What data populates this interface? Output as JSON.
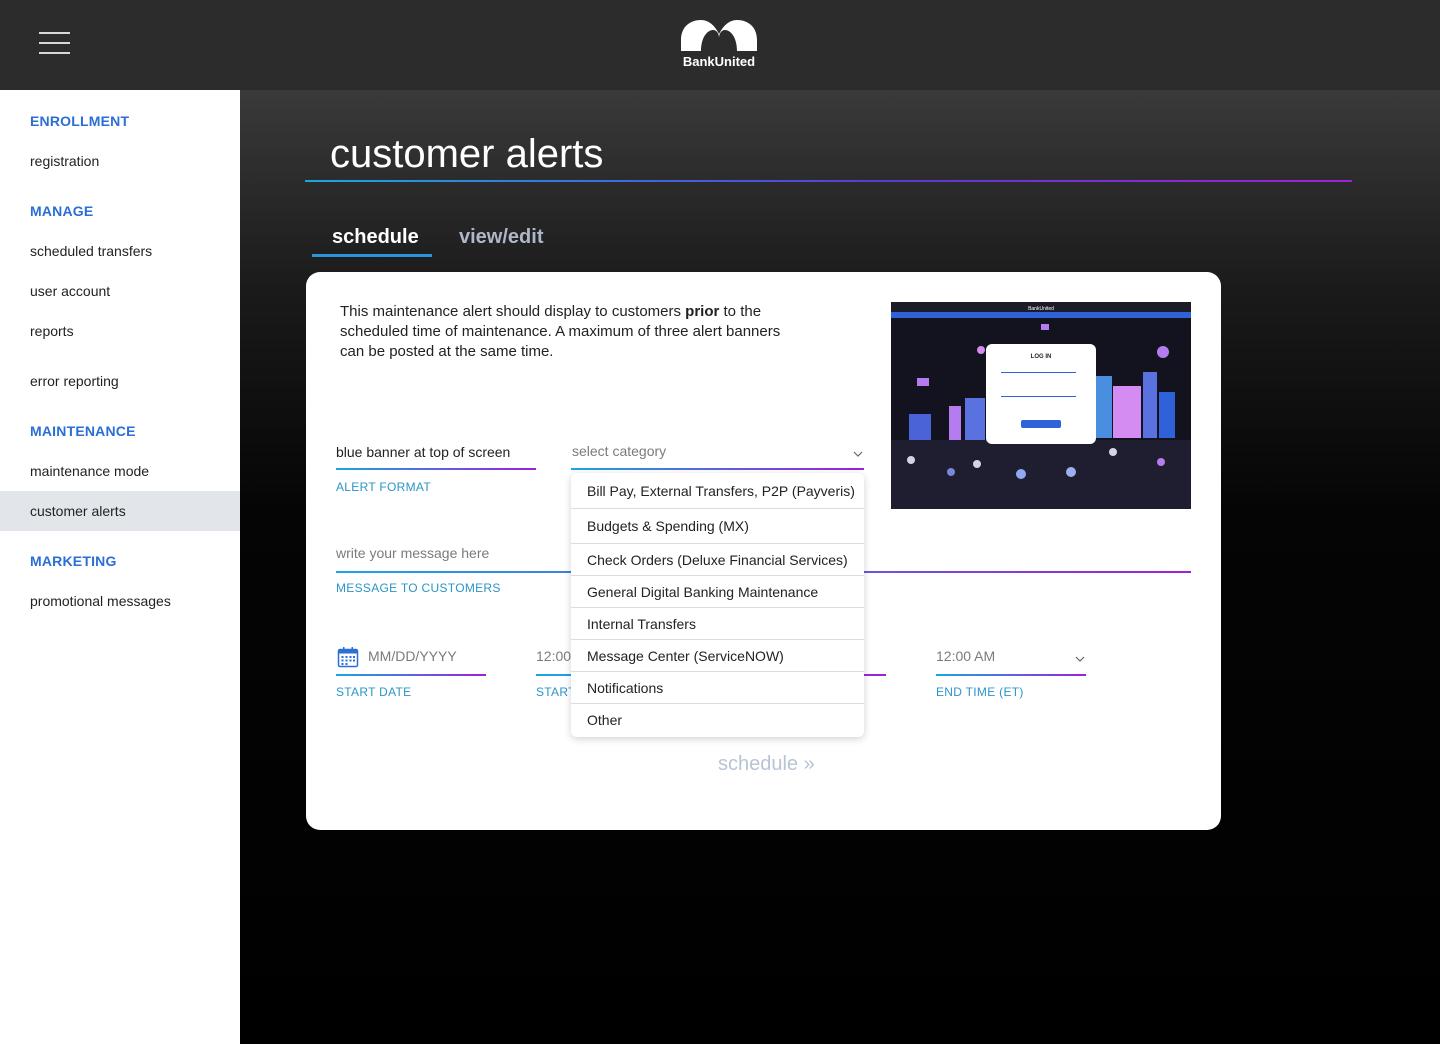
{
  "header": {
    "brand": "BankUnited",
    "menu_icon": "hamburger-menu-icon"
  },
  "sidebar": {
    "sections": [
      {
        "title": "ENROLLMENT",
        "items": [
          "registration"
        ]
      },
      {
        "title": "MANAGE",
        "items": [
          "scheduled transfers",
          "user account",
          "reports",
          "error reporting"
        ]
      },
      {
        "title": "MAINTENANCE",
        "items": [
          "maintenance mode",
          "customer alerts"
        ]
      },
      {
        "title": "MARKETING",
        "items": [
          "promotional messages"
        ]
      }
    ],
    "active_item": "customer alerts"
  },
  "page": {
    "title": "customer alerts",
    "tabs": [
      {
        "label": "schedule",
        "active": true
      },
      {
        "label": "view/edit",
        "active": false
      }
    ]
  },
  "form": {
    "intro_before": "This maintenance alert should display to customers ",
    "intro_bold": "prior",
    "intro_after": " to the scheduled time of maintenance. A maximum of three alert banners can be posted at the same time.",
    "alert_format": {
      "value": "blue banner at top of screen",
      "caption": "ALERT FORMAT"
    },
    "category": {
      "placeholder": "select category",
      "options": [
        "Bill Pay, External Transfers, P2P (Payveris)",
        "Budgets & Spending (MX)",
        "Check Orders (Deluxe Financial Services)",
        "General Digital Banking Maintenance",
        "Internal Transfers",
        "Message Center (ServiceNOW)",
        "Notifications",
        "Other"
      ]
    },
    "message": {
      "placeholder": "write your message here",
      "caption": "MESSAGE TO CUSTOMERS"
    },
    "start_date": {
      "placeholder": "MM/DD/YYYY",
      "caption": "START DATE"
    },
    "start_time": {
      "value": "12:00",
      "caption": "START"
    },
    "end_time": {
      "value": "12:00 AM",
      "caption": "END TIME (ET)"
    },
    "schedule_button": "schedule »"
  },
  "preview": {
    "login_title": "LOG IN",
    "brand": "BankUnited"
  },
  "colors": {
    "accent_blue": "#2a6ed6",
    "caption_blue": "#2a95c8",
    "gradient_start": "#1aa7e0",
    "gradient_end": "#a020d8"
  }
}
